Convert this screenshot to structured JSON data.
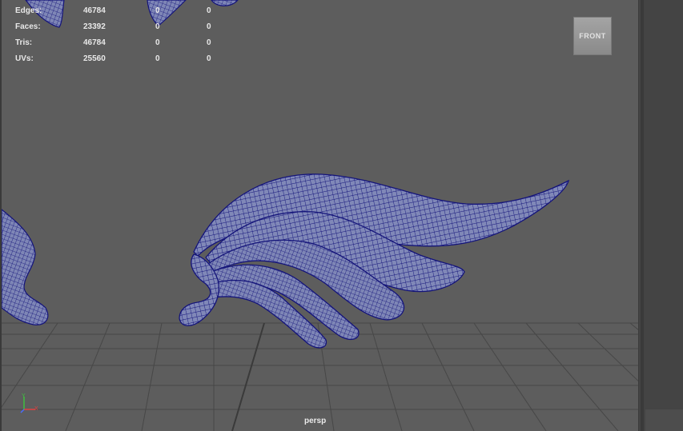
{
  "hud": {
    "rows": [
      {
        "label": "Edges:",
        "value": "46784",
        "sel": "0",
        "comp": "0"
      },
      {
        "label": "Faces:",
        "value": "23392",
        "sel": "0",
        "comp": "0"
      },
      {
        "label": "Tris:",
        "value": "46784",
        "sel": "0",
        "comp": "0"
      },
      {
        "label": "UVs:",
        "value": "25560",
        "sel": "0",
        "comp": "0"
      }
    ]
  },
  "view_cube": {
    "label": "FRONT"
  },
  "camera": {
    "label": "persp"
  },
  "axis": {
    "y_label": "Y",
    "x_label": "X",
    "y_color": "#3fbf3f",
    "x_color": "#e04040",
    "z_color": "#4a6cff"
  },
  "colors": {
    "viewport_bg": "#5d5d5d",
    "wireframe": "#14147a",
    "mesh_fill": "#7d86b5",
    "grid": "#474747"
  }
}
